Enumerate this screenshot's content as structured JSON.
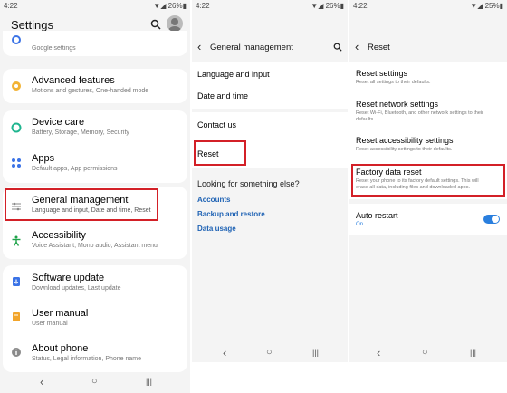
{
  "panel1": {
    "status": {
      "time": "4:22",
      "battery": "26%"
    },
    "title": "Settings",
    "partial_item_sub": "Google settings",
    "items": [
      {
        "label": "Advanced features",
        "sub": "Motions and gestures, One-handed mode"
      },
      {
        "label": "Device care",
        "sub": "Battery, Storage, Memory, Security"
      },
      {
        "label": "Apps",
        "sub": "Default apps, App permissions"
      },
      {
        "label": "General management",
        "sub": "Language and input, Date and time, Reset"
      },
      {
        "label": "Accessibility",
        "sub": "Voice Assistant, Mono audio, Assistant menu"
      },
      {
        "label": "Software update",
        "sub": "Download updates, Last update"
      },
      {
        "label": "User manual",
        "sub": "User manual"
      },
      {
        "label": "About phone",
        "sub": "Status, Legal information, Phone name"
      }
    ],
    "nav": {
      "back": "‹",
      "home": "○",
      "recents": "|||"
    }
  },
  "panel2": {
    "status": {
      "time": "4:22",
      "battery": "26%"
    },
    "title": "General management",
    "items": [
      "Language and input",
      "Date and time",
      "Contact us",
      "Reset"
    ],
    "looking": "Looking for something else?",
    "links": [
      "Accounts",
      "Backup and restore",
      "Data usage"
    ],
    "nav": {
      "back": "‹",
      "home": "○",
      "recents": "|||"
    }
  },
  "panel3": {
    "status": {
      "time": "4:22",
      "battery": "25%"
    },
    "title": "Reset",
    "items": [
      {
        "label": "Reset settings",
        "sub": "Reset all settings to their defaults."
      },
      {
        "label": "Reset network settings",
        "sub1": "Reset Wi-Fi, Bluetooth, and other network settings to their",
        "sub2": "defaults."
      },
      {
        "label": "Reset accessibility settings",
        "sub": "Reset accessibility settings to their defaults."
      },
      {
        "label": "Factory data reset",
        "sub1": "Reset your phone to its factory default settings. This will",
        "sub2": "erase all data, including files and downloaded apps."
      },
      {
        "label": "Auto restart",
        "sub": "On"
      }
    ],
    "nav": {
      "back": "‹",
      "home": "○",
      "recents": "|||"
    }
  },
  "colors": {
    "highlight": "#d32027",
    "link": "#1e62b4",
    "toggle": "#2a7fde"
  }
}
